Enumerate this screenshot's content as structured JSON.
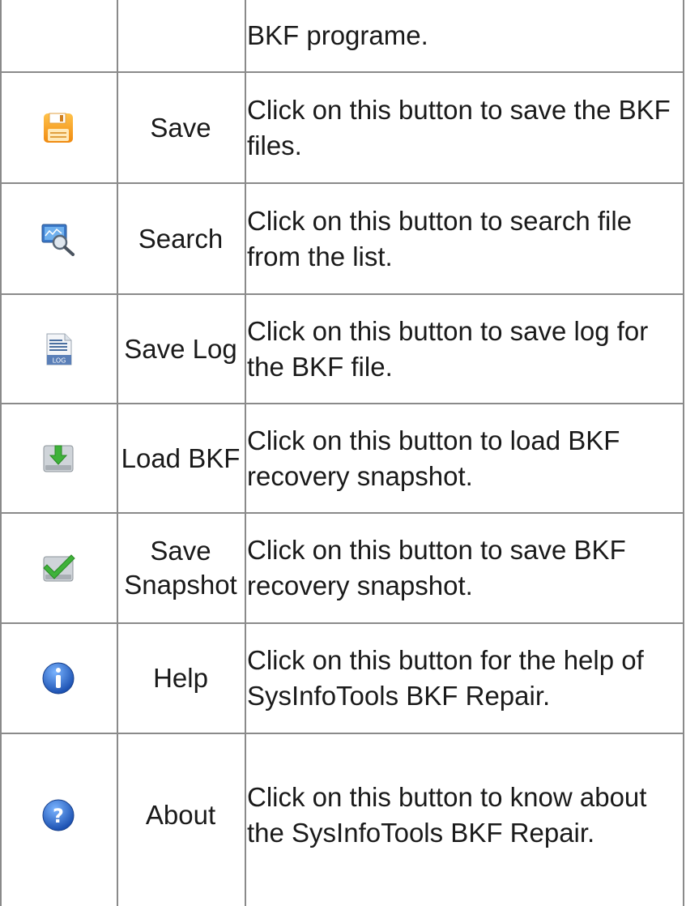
{
  "rows": [
    {
      "name": "",
      "description": "BKF programe.",
      "icon": ""
    },
    {
      "name": "Save",
      "description": "Click on this button to save the BKF files.",
      "icon": "floppy-disk-icon"
    },
    {
      "name": "Search",
      "description": "Click on this button to search file from the list.",
      "icon": "magnifier-monitor-icon"
    },
    {
      "name": "Save Log",
      "description": "Click on this button to save log for the BKF file.",
      "icon": "log-file-icon"
    },
    {
      "name": "Load BKF",
      "description": "Click on this button to load BKF recovery snapshot.",
      "icon": "drive-download-icon"
    },
    {
      "name": "Save Snapshot",
      "description": "Click on this button to save BKF recovery snapshot.",
      "icon": "drive-checkmark-icon"
    },
    {
      "name": "Help",
      "description": "Click on this button for the help of SysInfoTools BKF Repair.",
      "icon": "info-icon"
    },
    {
      "name": "About",
      "description": "Click on this button to know about the SysInfoTools BKF Repair.",
      "icon": "question-icon"
    }
  ],
  "colors": {
    "border": "#8a8a8a",
    "text": "#1a1a1a",
    "save_orange": "#f59a1a",
    "help_blue": "#1f5fc8",
    "check_green": "#3aa52a"
  }
}
